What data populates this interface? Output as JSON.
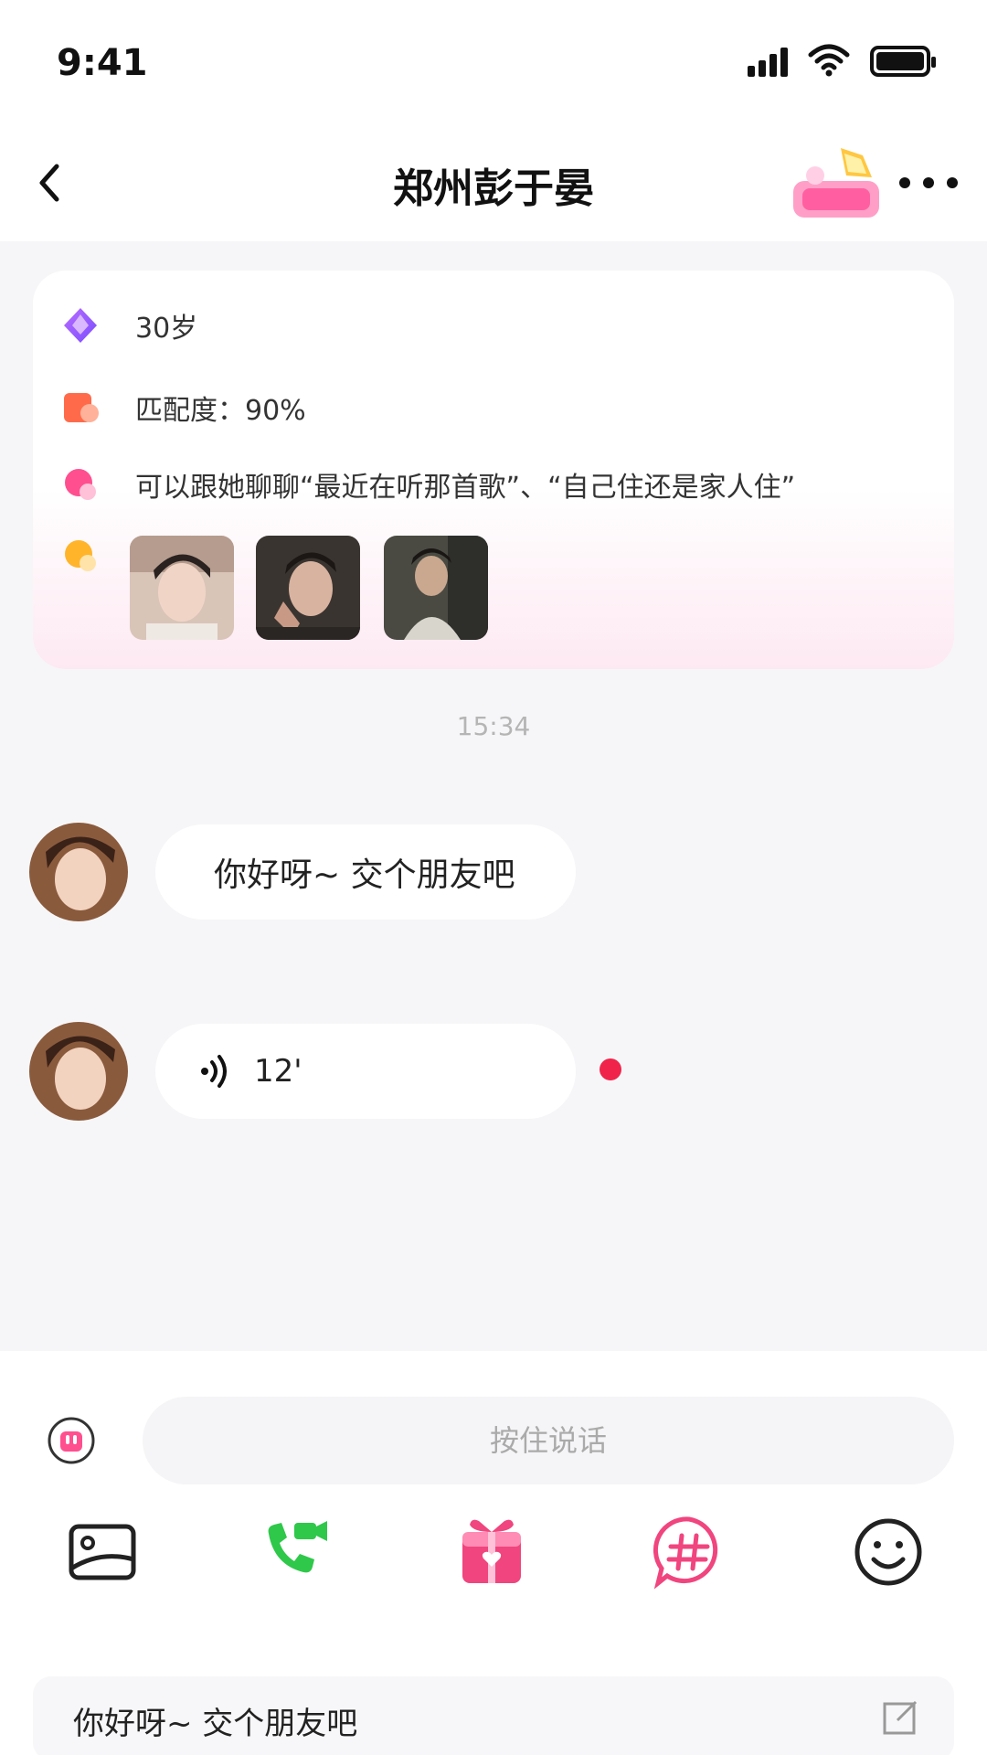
{
  "status_bar": {
    "time": "9:41"
  },
  "nav": {
    "title": "郑州彭于晏"
  },
  "profile": {
    "age": "30岁",
    "match": "匹配度：90%",
    "topics": "可以跟她聊聊“最近在听那首歌”、“自己住还是家人住”"
  },
  "chat": {
    "timestamp": "15:34",
    "messages": [
      {
        "type": "text",
        "text": "你好呀~ 交个朋友吧"
      },
      {
        "type": "voice",
        "duration": "12'"
      }
    ]
  },
  "composer": {
    "placeholder": "按住说话",
    "quick_reply": "你好呀~ 交个朋友吧"
  },
  "colors": {
    "accent_pink": "#f0457e",
    "call_green": "#2fc84a",
    "unread_red": "#f0244a"
  },
  "icons": [
    "back-icon",
    "badge-icon",
    "more-icon",
    "age-icon",
    "match-icon",
    "topic-icon",
    "photo-icon",
    "voice-wave-icon",
    "voice-toggle-icon",
    "image-icon",
    "video-call-icon",
    "gift-icon",
    "topic-hash-icon",
    "emoji-icon",
    "edit-icon"
  ]
}
